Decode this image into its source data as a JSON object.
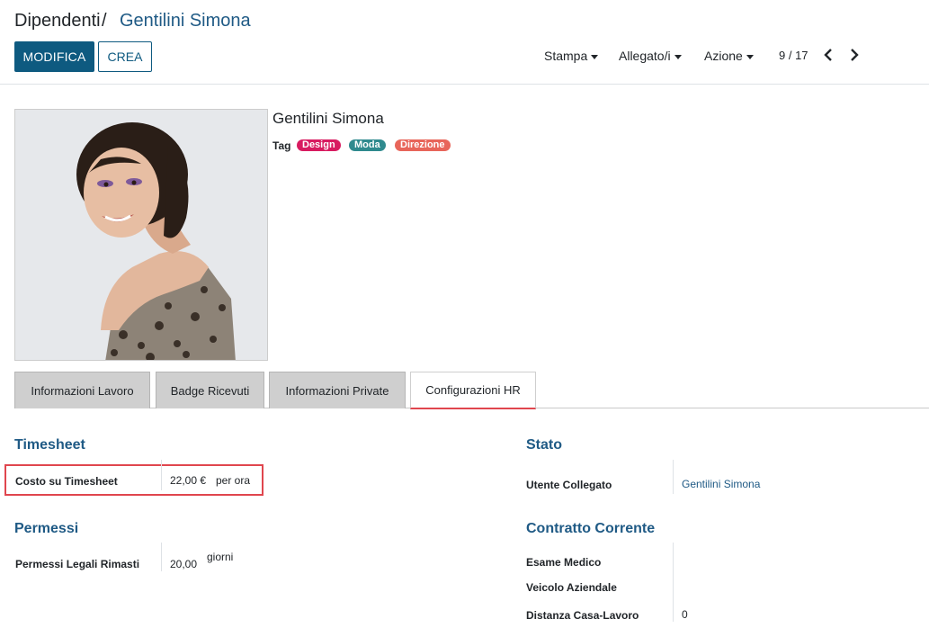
{
  "breadcrumb": {
    "root": "Dipendenti",
    "separator": "/",
    "current": "Gentilini Simona"
  },
  "toolbar": {
    "edit_label": "MODIFICA",
    "create_label": "CREA",
    "print_label": "Stampa",
    "attachments_label": "Allegato/i",
    "action_label": "Azione",
    "pager": "9 / 17"
  },
  "employee": {
    "name": "Gentilini Simona",
    "tag_label": "Tag",
    "tags": [
      {
        "label": "Design",
        "color": "#d81b60"
      },
      {
        "label": "Moda",
        "color": "#2f8a8e"
      },
      {
        "label": "Direzione",
        "color": "#e8655a"
      }
    ]
  },
  "tabs": [
    {
      "label": "Informazioni Lavoro"
    },
    {
      "label": "Badge Ricevuti"
    },
    {
      "label": "Informazioni Private"
    },
    {
      "label": "Configurazioni HR"
    }
  ],
  "timesheet": {
    "title": "Timesheet",
    "cost_label": "Costo su Timesheet",
    "cost_value": "22,00 €",
    "cost_unit": "per ora"
  },
  "leaves": {
    "title": "Permessi",
    "legal_label": "Permessi Legali Rimasti",
    "legal_value": "20,00",
    "legal_unit": "giorni"
  },
  "status": {
    "title": "Stato",
    "user_label": "Utente Collegato",
    "user_value": "Gentilini Simona"
  },
  "contract": {
    "title": "Contratto Corrente",
    "medical_label": "Esame Medico",
    "car_label": "Veicolo Aziendale",
    "distance_label": "Distanza Casa-Lavoro",
    "distance_value": "0"
  },
  "colors": {
    "primary": "#0e5a80",
    "link": "#1f5a85",
    "highlight": "#e0464e"
  }
}
